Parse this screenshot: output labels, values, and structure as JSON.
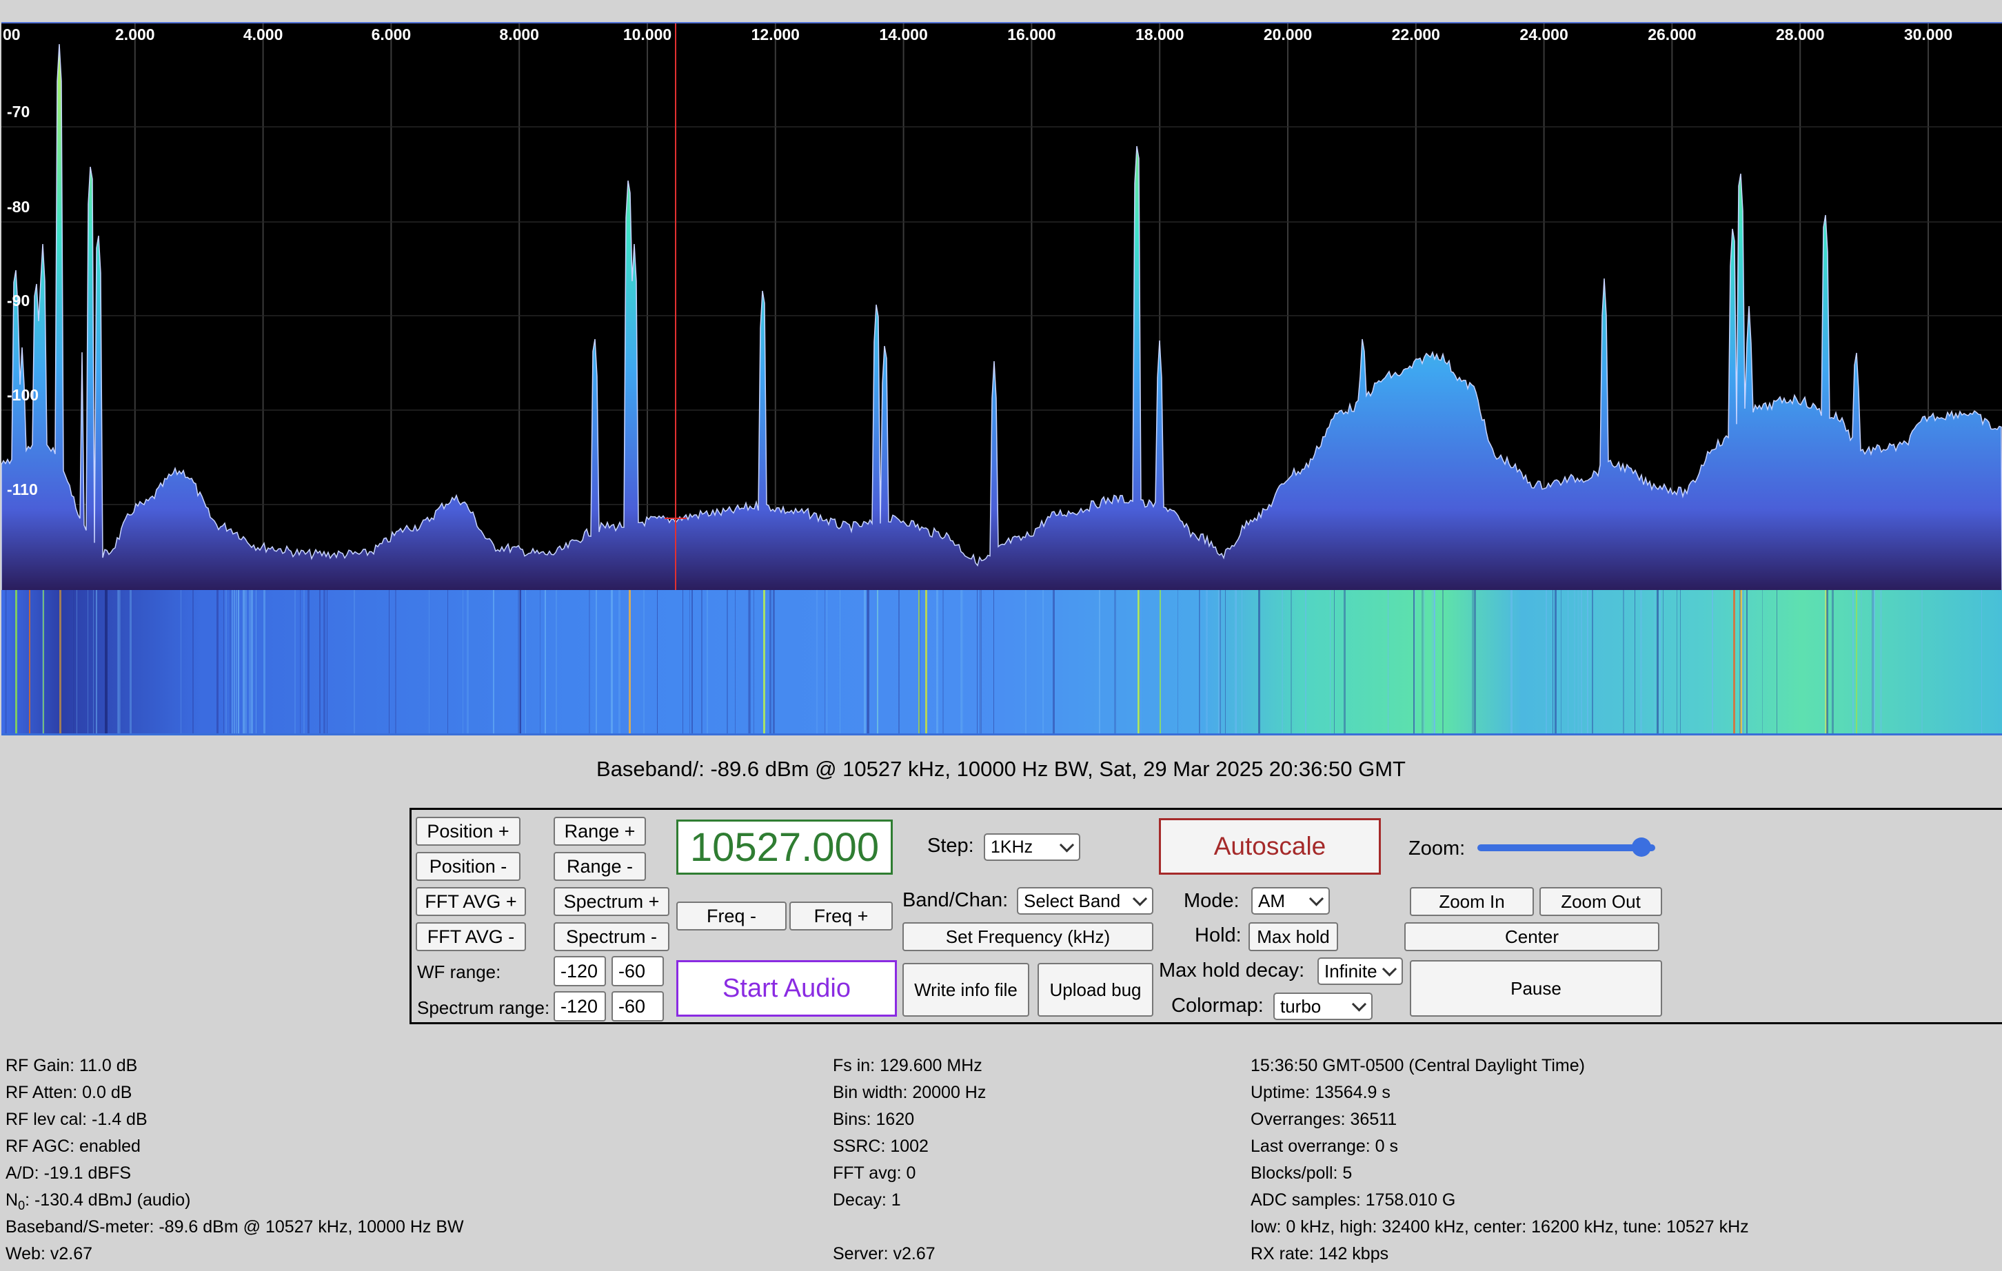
{
  "spectrum": {
    "x_axis_labels": [
      "00",
      "2.000",
      "4.000",
      "6.000",
      "8.000",
      "10.000",
      "12.000",
      "14.000",
      "16.000",
      "18.000",
      "20.000",
      "22.000",
      "24.000",
      "26.000",
      "28.000",
      "30.000"
    ],
    "y_axis_labels": [
      "-70",
      "-80",
      "-90",
      "-100",
      "-110"
    ],
    "colormap": "turbo"
  },
  "status_line": "Baseband/: -89.6 dBm @ 10527 kHz, 10000 Hz BW, Sat, 29 Mar 2025 20:36:50 GMT",
  "controls": {
    "position_plus": "Position +",
    "position_minus": "Position -",
    "fft_avg_plus": "FFT AVG +",
    "fft_avg_minus": "FFT AVG -",
    "range_plus": "Range +",
    "range_minus": "Range -",
    "spectrum_plus": "Spectrum +",
    "spectrum_minus": "Spectrum -",
    "wf_range_label": "WF range:",
    "wf_range_min": "-120",
    "wf_range_max": "-60",
    "spectrum_range_label": "Spectrum range:",
    "spectrum_range_min": "-120",
    "spectrum_range_max": "-60",
    "frequency": "10527.000",
    "freq_minus": "Freq -",
    "freq_plus": "Freq +",
    "start_audio": "Start Audio",
    "step_label": "Step:",
    "step_value": "1KHz",
    "band_label": "Band/Chan:",
    "band_value": "Select Band",
    "set_frequency": "Set Frequency (kHz)",
    "write_info": "Write info file",
    "upload_bug": "Upload bug",
    "autoscale": "Autoscale",
    "mode_label": "Mode:",
    "mode_value": "AM",
    "hold_label": "Hold:",
    "max_hold": "Max hold",
    "max_hold_decay_label": "Max hold decay:",
    "max_hold_decay_value": "Infinite",
    "colormap_label": "Colormap:",
    "colormap_value": "turbo",
    "zoom_label": "Zoom:",
    "zoom_level": 0.9,
    "zoom_in": "Zoom In",
    "zoom_out": "Zoom Out",
    "center": "Center",
    "pause": "Pause"
  },
  "info_left": [
    "RF Gain: 11.0 dB",
    "RF Atten: 0.0 dB",
    "RF lev cal: -1.4 dB",
    "RF AGC: enabled",
    "A/D: -19.1 dBFS",
    "",
    "Baseband/S-meter: -89.6 dBm @ 10527 kHz, 10000 Hz BW",
    "Web: v2.67"
  ],
  "noise_floor": {
    "prefix": "N",
    "sub": "0",
    "text": ": -130.4 dBmJ (audio)"
  },
  "info_mid": [
    "Fs in: 129.600 MHz",
    "Bin width: 20000 Hz",
    "Bins: 1620",
    "SSRC: 1002",
    "FFT avg: 0",
    "Decay: 1",
    "",
    "Server: v2.67"
  ],
  "info_right": [
    "15:36:50 GMT-0500 (Central Daylight Time)",
    "Uptime: 13564.9 s",
    "Overranges: 36511",
    "Last overrange: 0 s",
    "Blocks/poll: 5",
    "ADC samples: 1758.010 G",
    "low: 0 kHz, high: 32400 kHz, center: 16200 kHz, tune: 10527 kHz",
    "RX rate: 142 kbps"
  ],
  "colors": {
    "freq_green": "#2f7d32",
    "audio_purple": "#8a2be2",
    "autoscale_red": "#a52a2a",
    "slider_blue": "#3b6fe0"
  }
}
